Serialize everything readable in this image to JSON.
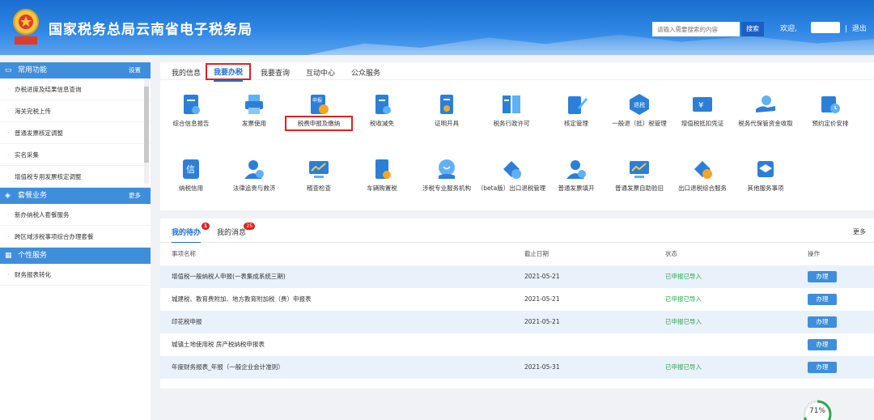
{
  "header": {
    "title": "国家税务总局云南省电子税务局",
    "search_placeholder": "请输入需要搜索的内容",
    "search_button": "搜索",
    "welcome": "欢迎,",
    "separator": "|",
    "logout": "退出"
  },
  "sidebar": {
    "common": {
      "title": "常用功能",
      "action": "设置",
      "items": [
        "办税进度及结果信息查询",
        "海关完税上传",
        "普通发票核定调整",
        "实名采集",
        "增值税专用发票核定调整"
      ]
    },
    "packages": {
      "title": "套餐业务",
      "action": "更多",
      "items": [
        "新办纳税人套餐服务",
        "跨区域涉税事项综合办理套餐"
      ]
    },
    "personal": {
      "title": "个性服务",
      "items": [
        "财务报表转化"
      ]
    }
  },
  "main_tabs": [
    "我的信息",
    "我要办税",
    "我要查询",
    "互动中心",
    "公众服务"
  ],
  "services": [
    {
      "label": "综合信息报告",
      "icon": "info-report-icon"
    },
    {
      "label": "发票使用",
      "icon": "printer-icon"
    },
    {
      "label": "税费申报及缴纳",
      "icon": "declare-pay-icon"
    },
    {
      "label": "税收减免",
      "icon": "tax-relief-icon"
    },
    {
      "label": "证明开具",
      "icon": "certificate-icon"
    },
    {
      "label": "税务行政许可",
      "icon": "admin-permit-icon"
    },
    {
      "label": "核定管理",
      "icon": "edit-doc-icon"
    },
    {
      "label": "一般退（抵）税管理",
      "icon": "tax-refund-icon"
    },
    {
      "label": "增值税抵扣凭证",
      "icon": "vat-voucher-icon"
    },
    {
      "label": "税务代保管资金收取",
      "icon": "hand-money-icon"
    },
    {
      "label": "预约定价安排",
      "icon": "calendar-clock-icon"
    },
    {
      "label": "纳税信用",
      "icon": "credit-icon"
    },
    {
      "label": "法律追责与救济",
      "icon": "legal-icon"
    },
    {
      "label": "稽查检查",
      "icon": "inspection-icon"
    },
    {
      "label": "车辆购置税",
      "icon": "vehicle-tax-icon"
    },
    {
      "label": "涉税专业服务机构",
      "icon": "service-agency-icon"
    },
    {
      "label": "（beta版）出口退税管理",
      "icon": "export-refund-icon"
    },
    {
      "label": "普通发票填开",
      "icon": "invoice-issue-icon"
    },
    {
      "label": "普通发票自助验旧",
      "icon": "invoice-verify-icon"
    },
    {
      "label": "出口退税综合服务",
      "icon": "export-service-icon"
    },
    {
      "label": "其他服务事项",
      "icon": "other-service-icon"
    }
  ],
  "todo": {
    "tabs": [
      {
        "label": "我的待办",
        "badge": "1"
      },
      {
        "label": "我的消息",
        "badge": "25"
      }
    ],
    "more": "更多",
    "columns": [
      "事项名称",
      "截止日期",
      "状态",
      "操作"
    ],
    "rows": [
      {
        "name": "增值税一般纳税人申报(一表集成系统三期)",
        "date": "2021-05-21",
        "status": "已申报已导入",
        "op": "办理"
      },
      {
        "name": "城建税、教育费附加、地方教育附加税（费）申报表",
        "date": "2021-05-21",
        "status": "已申报已导入",
        "op": "办理"
      },
      {
        "name": "印花税申报",
        "date": "2021-05-21",
        "status": "已申报已导入",
        "op": "办理"
      },
      {
        "name": "城镇土地使用税 房产税纳税申报表",
        "date": "",
        "status": "",
        "op": "办理"
      },
      {
        "name": "年度财务报表_年报（一般企业会计准则）",
        "date": "2021-05-31",
        "status": "已申报已导入",
        "op": "办理"
      }
    ]
  },
  "progress": {
    "value": "71%",
    "fraction": 0.71
  },
  "colors": {
    "brand_blue": "#1f6fd0",
    "sidebar_head": "#3f8edb",
    "status_green": "#2fa74b",
    "highlight_red": "#e02020"
  }
}
